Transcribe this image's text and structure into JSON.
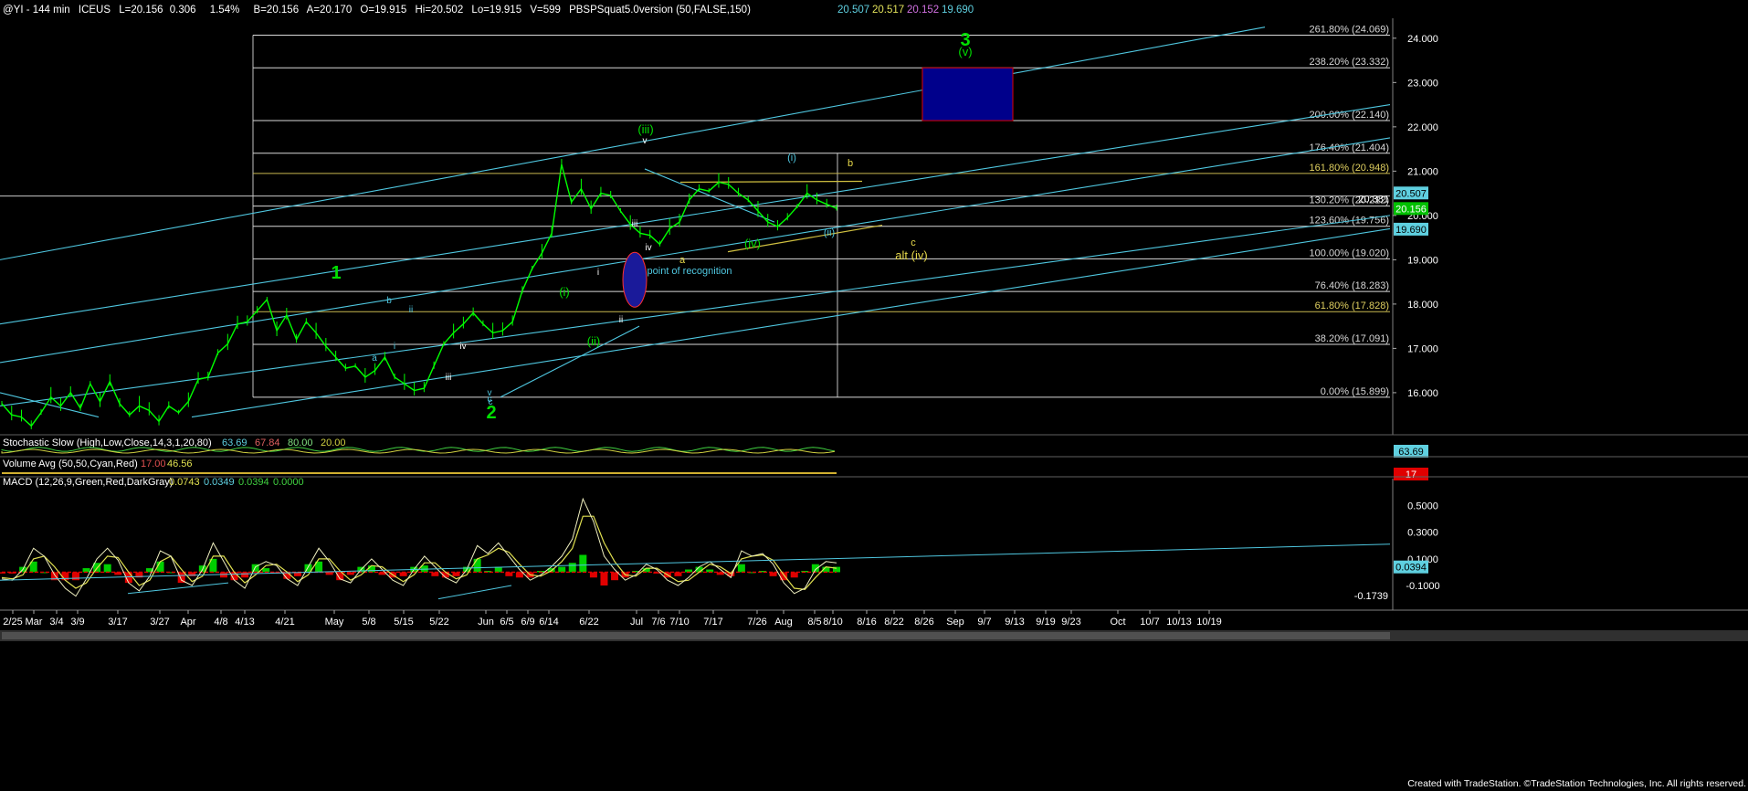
{
  "header": {
    "symbol": "@YI - 144 min",
    "exchange": "ICEUS",
    "last": "L=20.156",
    "change": "0.306",
    "change_pct": "1.54%",
    "bid": "B=20.156",
    "ask": "A=20.170",
    "open": "O=19.915",
    "high": "Hi=20.502",
    "low": "Lo=19.915",
    "volume": "V=599",
    "study": "PBSPSquat5.0version (50,FALSE,150)",
    "study_values": [
      {
        "value": "20.507",
        "color": "#5fd0e0"
      },
      {
        "value": "20.517",
        "color": "#e0e05a"
      },
      {
        "value": "20.152",
        "color": "#d070e0"
      },
      {
        "value": "19.690",
        "color": "#5fd0e0"
      }
    ]
  },
  "colors": {
    "price": "#00ff00",
    "channel": "#4fc7e0",
    "fib": "#d8d8d8",
    "fib_gold": "#c8b850",
    "wave_green": "#00e000",
    "wave_teal": "#4fc7e0",
    "wave_yellow": "#e6d84a",
    "target_box": "#00008b",
    "target_border": "#e00000"
  },
  "chart_data": [
    {
      "type": "line",
      "title": "@YI - 144 min",
      "x_ticks": [
        "2/25",
        "Mar",
        "3/4",
        "3/9",
        "3/17",
        "3/27",
        "Apr",
        "4/8",
        "4/13",
        "4/21",
        "May",
        "5/8",
        "5/15",
        "5/22",
        "Jun",
        "6/5",
        "6/9",
        "6/14",
        "6/22",
        "Jul",
        "7/6",
        "7/10",
        "7/17",
        "7/26",
        "Aug",
        "8/5",
        "8/10",
        "8/16",
        "8/22",
        "8/26",
        "Sep",
        "9/7",
        "9/13",
        "9/19",
        "9/23",
        "Oct",
        "10/7",
        "10/13",
        "10/19"
      ],
      "ylim": [
        15.05,
        24.45
      ],
      "y_ticks": [
        "16.000",
        "17.000",
        "18.000",
        "19.000",
        "20.000",
        "21.000",
        "22.000",
        "23.000",
        "24.000"
      ],
      "price_series": {
        "name": "price",
        "x": [
          0,
          3,
          6,
          9,
          12,
          15,
          18,
          21,
          24,
          27,
          30,
          33,
          36,
          39,
          42,
          45,
          48,
          51,
          54,
          57,
          60,
          63,
          66,
          69,
          72,
          75,
          78,
          81,
          84,
          87,
          90,
          93,
          96,
          99,
          102,
          105,
          108,
          111,
          114,
          117,
          120,
          123,
          126,
          129,
          132,
          135,
          138,
          141,
          144,
          147,
          150,
          153,
          156,
          159,
          162,
          165,
          168,
          171,
          174,
          177,
          180,
          183,
          186,
          189,
          192,
          195,
          198,
          201,
          204,
          207,
          210,
          213,
          216,
          219,
          222,
          225,
          228,
          231,
          234,
          237,
          240,
          243,
          246,
          249,
          252,
          255
        ],
        "y": [
          15.75,
          15.5,
          15.45,
          15.25,
          15.55,
          15.9,
          15.7,
          16.0,
          15.65,
          16.2,
          15.8,
          16.25,
          15.75,
          15.5,
          15.7,
          15.6,
          15.35,
          15.7,
          15.55,
          15.8,
          16.3,
          16.35,
          16.9,
          17.1,
          17.55,
          17.6,
          17.85,
          18.1,
          17.4,
          17.75,
          17.2,
          17.6,
          17.35,
          17.05,
          16.8,
          16.55,
          16.6,
          16.35,
          16.5,
          16.8,
          16.35,
          16.2,
          16.05,
          16.1,
          16.6,
          17.1,
          17.35,
          17.55,
          17.8,
          17.55,
          17.35,
          17.4,
          17.6,
          18.3,
          18.8,
          19.15,
          19.6,
          21.15,
          20.3,
          20.6,
          20.15,
          20.5,
          20.45,
          20.1,
          19.8,
          19.6,
          19.55,
          19.35,
          19.7,
          19.85,
          20.35,
          20.6,
          20.55,
          20.75,
          20.7,
          20.5,
          20.35,
          20.1,
          19.85,
          19.75,
          19.95,
          20.2,
          20.5,
          20.35,
          20.25,
          20.16
        ]
      },
      "fib_levels": [
        {
          "label": "261.80% (24.069)",
          "value": 24.069
        },
        {
          "label": "238.20% (23.332)",
          "value": 23.332
        },
        {
          "label": "200.00% (22.140)",
          "value": 22.14
        },
        {
          "label": "176.40% (21.404)",
          "value": 21.404
        },
        {
          "label": "161.80% (20.948)",
          "value": 20.948,
          "gold": true
        },
        {
          "label": "130.20% (20.212)",
          "value": 20.212
        },
        {
          "label": "123.60% (19.756)",
          "value": 19.756
        },
        {
          "label": "100.00% (19.020)",
          "value": 19.02
        },
        {
          "label": "76.40% (18.283)",
          "value": 18.283
        },
        {
          "label": "61.80% (17.828)",
          "value": 17.828,
          "gold": true
        },
        {
          "label": "38.20% (17.091)",
          "value": 17.091
        },
        {
          "label": "0.00% (15.899)",
          "value": 15.899
        }
      ],
      "price_markers": [
        {
          "label": "20.381",
          "value": 20.381,
          "bg": "#000000",
          "fg": "#ffffff"
        },
        {
          "label": "20.507",
          "value": 20.507,
          "bg": "#5fd0e0",
          "fg": "#000000"
        },
        {
          "label": "20.156",
          "value": 20.156,
          "bg": "#00c000",
          "fg": "#ffffff"
        },
        {
          "label": "19.690",
          "value": 19.69,
          "bg": "#5fd0e0",
          "fg": "#000000"
        }
      ],
      "wave_labels": [
        {
          "text": "1",
          "color": "green",
          "big": true
        },
        {
          "text": "2",
          "color": "green",
          "big": true
        },
        {
          "text": "3",
          "color": "green",
          "big": true
        },
        {
          "text": "(v)",
          "color": "green"
        },
        {
          "text": "(iii)",
          "color": "green"
        },
        {
          "text": "(iv)",
          "color": "green"
        },
        {
          "text": "(i)",
          "color": "green"
        },
        {
          "text": "(ii)",
          "color": "green"
        },
        {
          "text": "(i)",
          "color": "teal"
        },
        {
          "text": "(ii)",
          "color": "teal"
        },
        {
          "text": "alt (iv)",
          "color": "yellow"
        },
        {
          "text": "a",
          "color": "yellow"
        },
        {
          "text": "b",
          "color": "yellow"
        },
        {
          "text": "c",
          "color": "yellow"
        },
        {
          "text": "point of recognition",
          "color": "teal"
        },
        {
          "text": "v",
          "color": "white"
        },
        {
          "text": "iv",
          "color": "white"
        },
        {
          "text": "iii",
          "color": "white"
        },
        {
          "text": "ii",
          "color": "white"
        },
        {
          "text": "i",
          "color": "white"
        },
        {
          "text": "a",
          "color": "teal"
        },
        {
          "text": "b",
          "color": "teal"
        },
        {
          "text": "c",
          "color": "teal"
        },
        {
          "text": "i",
          "color": "teal"
        },
        {
          "text": "ii",
          "color": "teal"
        },
        {
          "text": "iii",
          "color": "white"
        },
        {
          "text": "iv",
          "color": "white"
        },
        {
          "text": "v",
          "color": "teal"
        },
        {
          "text": "c",
          "color": "teal"
        }
      ]
    },
    {
      "type": "line",
      "title": "Stochastic Slow (High,Low,Close,14,3,1,20,80)",
      "values": [
        "63.69",
        "67.84",
        "80.00",
        "20.00"
      ],
      "marker": "63.69"
    },
    {
      "type": "bar",
      "title": "Volume Avg (50,50,Cyan,Red)",
      "values": [
        "17.00",
        "46.56"
      ],
      "marker": "17"
    },
    {
      "type": "bar",
      "title": "MACD (12,26,9,Green,Red,DarkGray)",
      "values": [
        "0.0743",
        "0.0349",
        "0.0394",
        "0.0000"
      ],
      "ylim": [
        -0.23,
        0.62
      ],
      "y_ticks": [
        "0.5000",
        "0.3000",
        "0.1000",
        "-0.1000"
      ],
      "marker": "0.0394",
      "low_marker": "-0.1739",
      "macd": [
        -0.05,
        -0.06,
        0.02,
        0.18,
        0.12,
        -0.02,
        -0.12,
        -0.18,
        -0.05,
        0.1,
        0.18,
        0.09,
        -0.08,
        -0.14,
        -0.03,
        0.16,
        0.12,
        -0.06,
        -0.1,
        0.02,
        0.22,
        0.08,
        -0.06,
        -0.12,
        0.04,
        0.08,
        0.05,
        -0.05,
        -0.1,
        0.04,
        0.18,
        0.08,
        -0.05,
        -0.08,
        0.02,
        0.1,
        0.02,
        -0.06,
        -0.1,
        0.02,
        0.12,
        0.04,
        -0.04,
        -0.08,
        0.02,
        0.2,
        0.14,
        0.22,
        0.12,
        0.02,
        -0.06,
        -0.02,
        0.04,
        0.12,
        0.25,
        0.55,
        0.38,
        0.12,
        0.02,
        -0.06,
        -0.02,
        0.06,
        0.02,
        -0.06,
        -0.1,
        -0.04,
        0.04,
        0.08,
        0.02,
        -0.04,
        0.16,
        0.12,
        0.14,
        0.06,
        -0.08,
        -0.16,
        -0.12,
        0.02,
        0.08,
        0.07
      ],
      "signal": [
        -0.04,
        -0.05,
        -0.02,
        0.1,
        0.12,
        0.04,
        -0.06,
        -0.12,
        -0.08,
        0.03,
        0.12,
        0.11,
        0.0,
        -0.1,
        -0.06,
        0.08,
        0.12,
        0.02,
        -0.07,
        -0.03,
        0.12,
        0.12,
        0.0,
        -0.08,
        -0.02,
        0.05,
        0.06,
        0.0,
        -0.07,
        -0.02,
        0.1,
        0.1,
        0.01,
        -0.06,
        -0.02,
        0.05,
        0.04,
        -0.02,
        -0.07,
        -0.02,
        0.07,
        0.07,
        0.0,
        -0.05,
        -0.02,
        0.1,
        0.13,
        0.18,
        0.15,
        0.06,
        -0.02,
        -0.03,
        0.01,
        0.08,
        0.18,
        0.42,
        0.42,
        0.22,
        0.08,
        -0.02,
        -0.03,
        0.03,
        0.03,
        -0.02,
        -0.07,
        -0.06,
        0.0,
        0.06,
        0.04,
        -0.01,
        0.1,
        0.12,
        0.13,
        0.09,
        -0.02,
        -0.12,
        -0.13,
        -0.04,
        0.04,
        0.03
      ]
    }
  ],
  "time_axis_label": "x_ticks",
  "footer": "Created with TradeStation. ©TradeStation Technologies, Inc. All rights reserved."
}
